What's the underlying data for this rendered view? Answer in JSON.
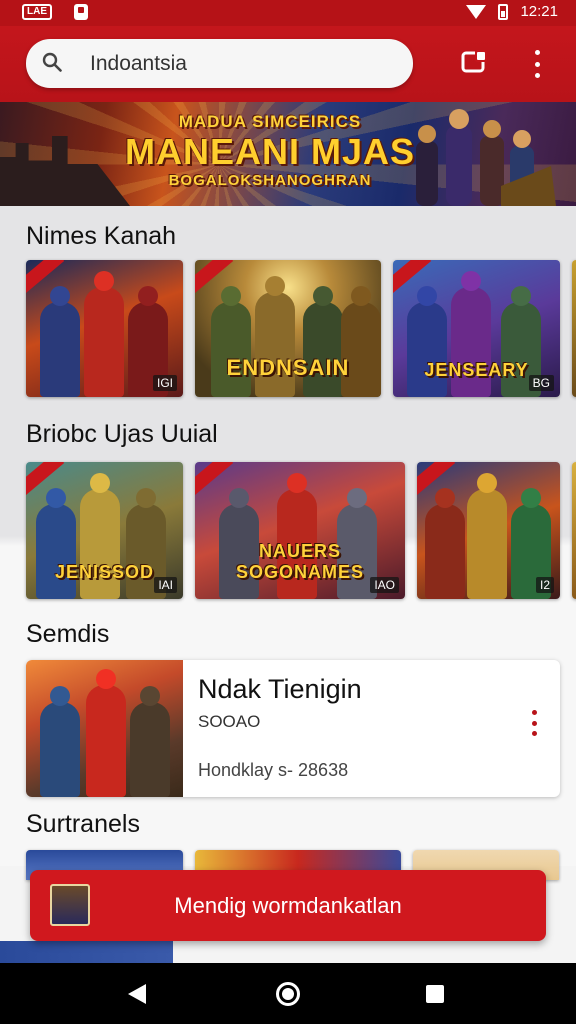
{
  "status_bar": {
    "badge": "LAE",
    "time": "12:21"
  },
  "search": {
    "value": "Indoantsia",
    "placeholder": ""
  },
  "banner": {
    "line1": "MADUA SIMCEIRICS",
    "line2": "MANEANI MJAS",
    "line3": "BOGALOKSHANOGHRAN"
  },
  "sections": {
    "nimes_kanah": {
      "title": "Nimes Kanah",
      "cards": [
        {
          "title": "",
          "count": "IGI"
        },
        {
          "title": "ENDNSAIN",
          "count": ""
        },
        {
          "title": "JENSEARY",
          "count": "BG"
        }
      ]
    },
    "briobc_ujas": {
      "title": "Briobc Ujas Uuial",
      "cards": [
        {
          "title": "JENISSOD",
          "count": "IAI"
        },
        {
          "title": "NAUERS SOGONAMES",
          "count": "IAO"
        },
        {
          "title": "",
          "count": "I2"
        }
      ]
    },
    "semdis": {
      "title": "Semdis",
      "item": {
        "title": "Ndak Tienigin",
        "subtitle": "SOOAO",
        "meta": "Hondklay s- 28638"
      }
    },
    "surtranels": {
      "title": "Surtranels"
    }
  },
  "snackbar": {
    "text": "Mendig wormdankatlan"
  },
  "colors": {
    "primary": "#c4161c",
    "accent_gold": "#ffd23a"
  }
}
